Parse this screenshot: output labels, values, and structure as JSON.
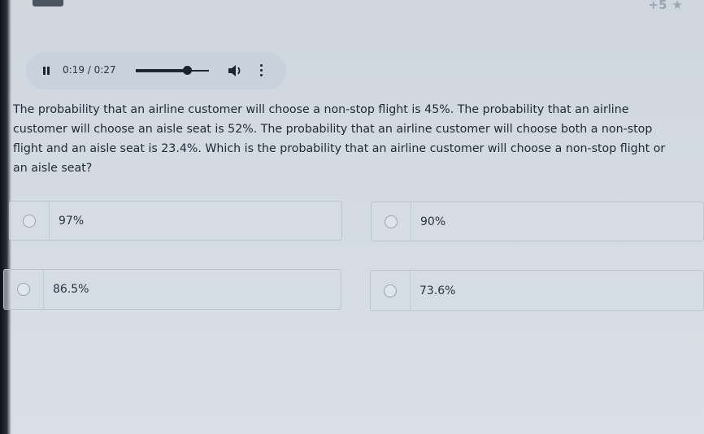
{
  "header": {
    "points_label": "+5",
    "points_icon": "star-icon"
  },
  "audio": {
    "time_label": "0:19 / 0:27",
    "progress": 0.704,
    "icons": [
      "pause-icon",
      "volume-icon",
      "more-vert-icon"
    ]
  },
  "question": {
    "lines": [
      "The probability that an airline customer will choose a non-stop flight is 45%. The probability that an airline",
      "customer will choose an aisle seat is 52%. The probability that an airline customer will choose both a non-stop",
      "flight and an aisle seat is 23.4%. Which is the probability that an airline customer will choose a non-stop flight or",
      "an aisle seat?"
    ]
  },
  "options": [
    {
      "label": "97%"
    },
    {
      "label": "90%"
    },
    {
      "label": "86.5%"
    },
    {
      "label": "73.6%"
    }
  ],
  "colors": {
    "background": "#d3dae2",
    "text": "#1f2933",
    "player_bg": "#c9d1da",
    "radio_border": "#9aa5b1"
  }
}
